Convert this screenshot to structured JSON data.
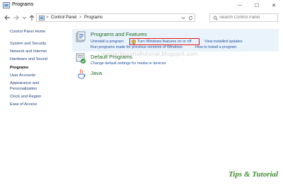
{
  "window": {
    "title": "Programs",
    "minimize_glyph": "—",
    "maximize_glyph": "☐",
    "close_glyph": "✕"
  },
  "address": {
    "breadcrumb_root": "Control Panel",
    "breadcrumb_current": "Programs",
    "separator": ">"
  },
  "search": {
    "placeholder": "Search Control Panel"
  },
  "sidebar": {
    "home": "Control Panel Home",
    "items": [
      {
        "label": "System and Security",
        "current": false
      },
      {
        "label": "Network and Internet",
        "current": false
      },
      {
        "label": "Hardware and Sound",
        "current": false
      },
      {
        "label": "Programs",
        "current": true
      },
      {
        "label": "User Accounts",
        "current": false
      },
      {
        "label": "Appearance and",
        "current": false
      },
      {
        "label": "Personalization",
        "current": false
      },
      {
        "label": "Clock and Region",
        "current": false
      },
      {
        "label": "Ease of Access",
        "current": false
      }
    ]
  },
  "categories": {
    "programs_features": {
      "title": "Programs and Features",
      "links": [
        "Uninstall a program",
        "Turn Windows features on or off",
        "View installed updates",
        "Run programs made for previous versions of Windows",
        "How to install a program"
      ]
    },
    "default_programs": {
      "title": "Default Programs",
      "links": [
        "Change default settings for media or devices"
      ]
    },
    "java": {
      "title": "Java"
    }
  },
  "watermark": "mastertipsorialtutorial.blogspot.com",
  "brand": "Tips & Tutorial",
  "colors": {
    "accent_link": "#1f4f9b",
    "category_title": "#1f6b24",
    "highlight": "#e01818",
    "selection_band": "#eaf3fb"
  }
}
